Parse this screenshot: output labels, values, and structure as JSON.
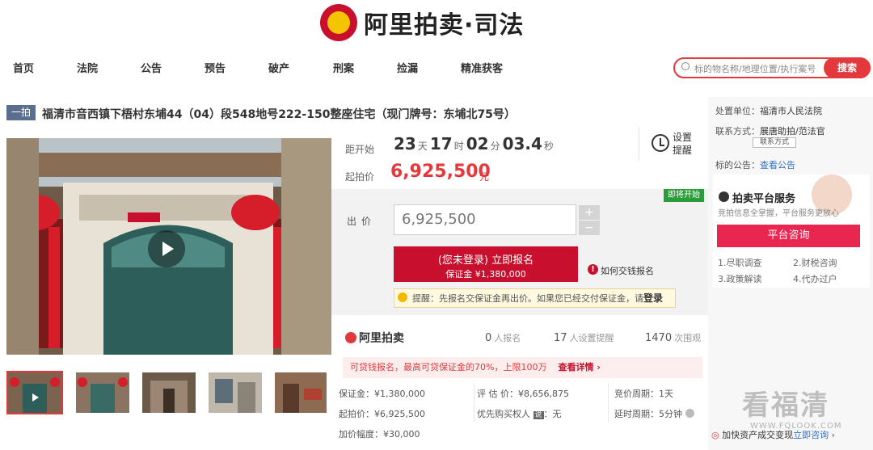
{
  "header": {
    "brand": "阿里拍卖·司法"
  },
  "nav": [
    "首页",
    "法院",
    "公告",
    "预告",
    "破产",
    "刑案",
    "捡漏",
    "精准获客"
  ],
  "search": {
    "placeholder": "标的物名称/地理位置/执行案号",
    "button": "搜索"
  },
  "lot": {
    "badge": "一拍",
    "title": "福清市音西镇下梧村东埔44（04）段548地号222-150整座住宅（现门牌号：东埔北75号）"
  },
  "countdown": {
    "label": "距开始",
    "days": "23",
    "days_unit": "天",
    "hours": "17",
    "hours_unit": "时",
    "minutes": "02",
    "minutes_unit": "分",
    "seconds": "03.4",
    "seconds_unit": "秒",
    "reminder_label": "设置提醒"
  },
  "start_price": {
    "label": "起拍价",
    "value": "6,925,500",
    "unit": "元"
  },
  "bid": {
    "status_badge": "即将开始",
    "label": "出价",
    "value": "6,925,500",
    "plus": "+",
    "minus": "−",
    "apply_line1": "(您未登录) 立即报名",
    "apply_line2": "保证金 ¥1,380,000",
    "how_to_pay": "如何交钱报名",
    "tip_text": "提醒：先报名交保证金再出价。如果您已经交付保证金，请",
    "tip_login": "登录"
  },
  "stats": {
    "logo": "阿里拍卖",
    "signups": "0",
    "signups_unit": "人报名",
    "reminders": "17",
    "reminders_unit": "人设置提醒",
    "views": "1470",
    "views_unit": "次围观"
  },
  "promo": {
    "text": "可贷钱报名，最高可贷保证金的70%，上限100万",
    "link": "查看详情 ›"
  },
  "details": {
    "deposit": "保证金：¥1,380,000",
    "appraisal": "评 估 价：¥8,656,875",
    "cycle": "竞价周期：1天",
    "start": "起拍价：¥6,925,500",
    "priority": "优先购买权人",
    "priority_tag": "说",
    "priority_value": "：无",
    "delay": "延时周期：5分钟",
    "increment": "加价幅度：¥30,000"
  },
  "sidebar": {
    "court_label": "处置单位：",
    "court": "福清市人民法院",
    "contact_label": "联系方式：",
    "contact": "展唐助拍/范法官",
    "contact_btn": "联系方式",
    "notice_label": "标的公告：",
    "notice_link": "查看公告",
    "service_title": "拍卖平台服务",
    "service_sub": "竞拍信息全掌握，平台服务更放心",
    "consult": "平台咨询",
    "items": [
      "1.尽职调查",
      "2.财税咨询",
      "3.政策解读",
      "4.代办过户"
    ],
    "bottom_text": "加快资产成交变现",
    "bottom_link": "立即咨询"
  },
  "watermark": {
    "text": "看福清",
    "url": "WWW.FQLOOK.COM"
  },
  "colors": {
    "accent": "#e4393c",
    "badge": "#5a6f8f",
    "green": "#2a9d3a"
  }
}
